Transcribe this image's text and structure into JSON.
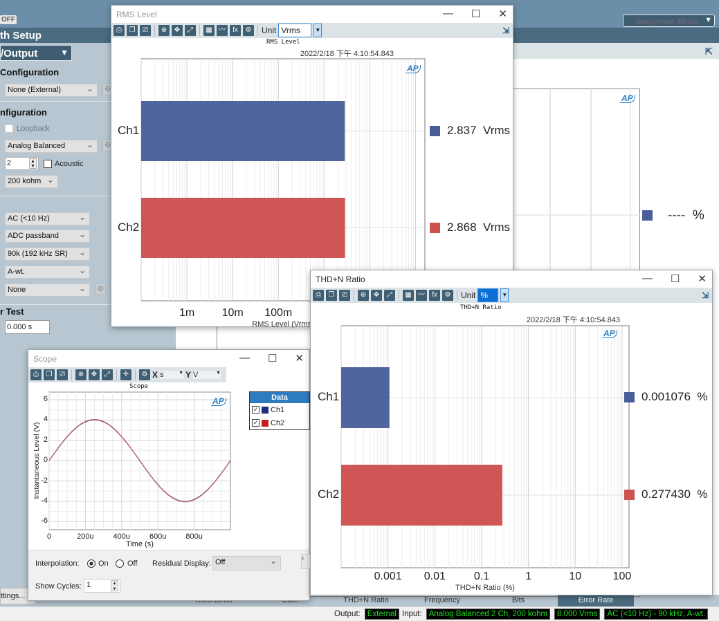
{
  "app": {
    "toggle_label": "OFF",
    "setup_title": "th Setup",
    "output_dropdown": "/Output",
    "sequence_mode": "Sequence Mode"
  },
  "left_panel": {
    "sections": [
      {
        "title": "Configuration"
      },
      {
        "title": "nfiguration"
      },
      {
        "title": "r Test"
      }
    ],
    "generator_config": "None (External)",
    "loopback_label": "Loopback",
    "input_type": "Analog Balanced",
    "channels": "2",
    "acoustic_label": "Acoustic",
    "impedance": "200 kohm",
    "coupling": "AC (<10 Hz)",
    "bandwidth": "ADC passband",
    "rate": "90k (192 kHz SR)",
    "weighting": "A-wt.",
    "filter": "None",
    "delay_value": "0.000 s",
    "settings_button": "ttings..."
  },
  "background_meter": {
    "value_text": "----",
    "unit": "%",
    "color": "#4a5f9a"
  },
  "bottom_tabs": [
    "RMS Level",
    "Gain",
    "THD+N Ratio",
    "Frequency",
    "Bits",
    "Error Rate"
  ],
  "bottom_tabs_selected": "Error Rate",
  "status_bar": {
    "output_label": "Output:",
    "output_value": "External",
    "input_label": "Input:",
    "input_value": "Analog Balanced 2 Ch, 200 kohm",
    "range_value": "8.000 Vrms",
    "filter_value": "AC (<10 Hz) - 90 kHz, A-wt."
  },
  "rms_window": {
    "title": "RMS Level",
    "unit_label": "Unit",
    "unit_value": "Vrms",
    "timestamp": "2022/2/18 下午 4:10:54.843",
    "logo": "AP",
    "readouts": [
      "2.837  Vrms",
      "2.868  Vrms"
    ]
  },
  "thd_window": {
    "title": "THD+N Ratio",
    "unit_label": "Unit",
    "unit_value": "%",
    "timestamp": "2022/2/18 下午 4:10:54.843",
    "logo": "AP",
    "readouts": [
      "0.001076  %",
      "0.277430  %"
    ]
  },
  "scope_window": {
    "title": "Scope",
    "x_label": "X",
    "x_unit": "s",
    "y_label": "Y",
    "y_unit": "V",
    "logo": "AP",
    "legend_title": "Data",
    "legend": [
      {
        "name": "Ch1",
        "color": "#1c2f7a",
        "checked": true
      },
      {
        "name": "Ch2",
        "color": "#c42020",
        "checked": true
      }
    ],
    "interpolation_label": "Interpolation:",
    "interp_on": "On",
    "interp_off": "Off",
    "interp_selected": "On",
    "residual_label": "Residual Display:",
    "residual_value": "Off",
    "cycles_label": "Show Cycles:",
    "cycles_value": "1"
  },
  "chart_data": [
    {
      "type": "bar",
      "orientation": "horizontal",
      "title": "RMS Level",
      "xlabel": "RMS Level (Vrms)",
      "xscale": "log",
      "xlim": [
        0.0001,
        160
      ],
      "xticks": [
        "1m",
        "10m",
        "100m"
      ],
      "xtick_values": [
        0.001,
        0.01,
        0.1
      ],
      "categories": [
        "Ch1",
        "Ch2"
      ],
      "values": [
        2.837,
        2.868
      ],
      "colors": [
        "#4a5f9a",
        "#cc5250"
      ],
      "grid": true
    },
    {
      "type": "bar",
      "orientation": "horizontal",
      "title": "THD+N Ratio",
      "xlabel": "THD+N Ratio (%)",
      "xscale": "log",
      "xlim": [
        0.0001,
        141
      ],
      "xticks": [
        "0.001",
        "0.01",
        "0.1",
        "1",
        "10",
        "100"
      ],
      "xtick_values": [
        0.001,
        0.01,
        0.1,
        1,
        10,
        100
      ],
      "categories": [
        "Ch1",
        "Ch2"
      ],
      "values": [
        0.001076,
        0.27743
      ],
      "colors": [
        "#4a5f9a",
        "#cc5250"
      ],
      "grid": true
    },
    {
      "type": "line",
      "title": "Scope",
      "xlabel": "Time (s)",
      "ylabel": "Instantaneous Level (V)",
      "xlim": [
        0,
        0.001
      ],
      "ylim": [
        -6.8,
        6.75
      ],
      "xticks": [
        "0",
        "200u",
        "400u",
        "600u",
        "800u"
      ],
      "xtick_values": [
        0,
        0.0002,
        0.0004,
        0.0006,
        0.0008
      ],
      "yticks": [
        "6",
        "4",
        "2",
        "0",
        "-2",
        "-4",
        "-6"
      ],
      "ytick_values": [
        6,
        4,
        2,
        0,
        -2,
        -4,
        -6
      ],
      "series": [
        {
          "name": "Ch1",
          "color": "#2b3f8f",
          "amplitude": 4.012,
          "frequency": 1000
        },
        {
          "name": "Ch2",
          "color": "#d06060",
          "amplitude": 4.056,
          "frequency": 1000
        }
      ],
      "grid": true
    }
  ]
}
